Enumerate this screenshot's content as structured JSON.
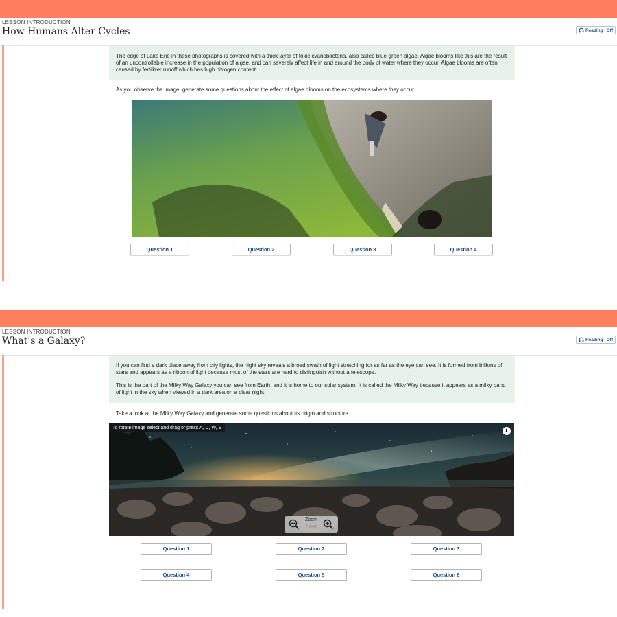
{
  "lesson1": {
    "kicker": "LESSON INTRODUCTION",
    "title": "How Humans Alter Cycles",
    "reading": {
      "label": "Reading",
      "state": "Off"
    },
    "callout": "The edge of Lake Erie in these photographs is covered with a thick layer of toxic cyanobacteria, also called blue-green algae. Algae blooms like this are the result of an uncontrollable increase in the population of algae, and can severely affect life in and around the body of water where they occur. Algae blooms are often caused by fertilizer runoff which has high nitrogen content.",
    "prompt": "As you observe the image, generate some questions about the effect of algae blooms on the ecosystems where they occur.",
    "buttons": [
      "Question 1",
      "Question 2",
      "Question 3",
      "Question 4"
    ]
  },
  "lesson2": {
    "kicker": "LESSON INTRODUCTION",
    "title": "What's a Galaxy?",
    "reading": {
      "label": "Reading",
      "state": "Off"
    },
    "callout_p1": "If you can find a dark place away from city lights, the night sky reveals a broad swath of light stretching for as far as the eye can see. It is formed from billions of stars and appears as a ribbon of light because most of the stars are hard to distinguish without a telescope.",
    "callout_p2": "This is the part of the Milky Way Galaxy you can see from Earth, and it is home to our solar system. It is called the Milky Way because it appears as a milky band of light in the sky when viewed in a dark area on a clear night.",
    "prompt": "Take a look at the Milky Way Galaxy and generate some questions about its origin and structure.",
    "image_hint": "To rotate image select and drag or press A, D, W, S",
    "info_glyph": "i",
    "zoom_label": "Zoom",
    "reset_label": "Reset",
    "buttons": [
      "Question 1",
      "Question 2",
      "Question 3",
      "Question 4",
      "Question 5",
      "Question 6"
    ]
  },
  "colors": {
    "accent": "#ff7e5d",
    "callout_bg": "#e7f3ea",
    "link": "#1f4e8a"
  }
}
